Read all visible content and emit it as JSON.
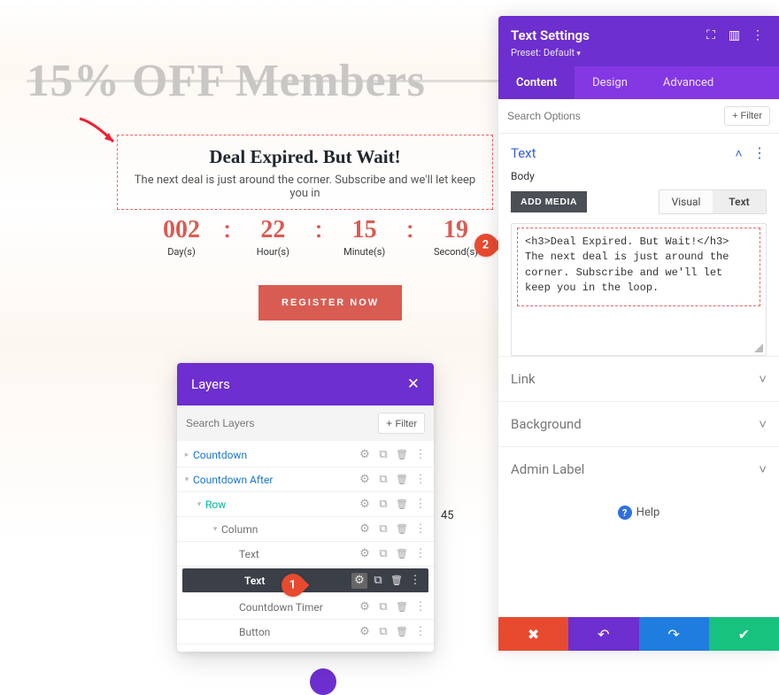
{
  "hero": {
    "strike_text": "15% OFF Members"
  },
  "deal": {
    "heading": "Deal Expired. But Wait!",
    "sub": "The next deal is just around the corner. Subscribe and we'll let keep you in"
  },
  "countdown": {
    "days": "002",
    "hours": "22",
    "minutes": "15",
    "seconds": "19",
    "day_lbl": "Day(s)",
    "hour_lbl": "Hour(s)",
    "minute_lbl": "Minute(s)",
    "second_lbl": "Second(s)"
  },
  "cta": {
    "register": "REGISTER NOW"
  },
  "layers": {
    "title": "Layers",
    "search_placeholder": "Search Layers",
    "filter": "Filter",
    "items": [
      {
        "label": "Countdown",
        "depth": 0,
        "cls": "lr-blue",
        "toggle": "▸"
      },
      {
        "label": "Countdown After",
        "depth": 0,
        "cls": "lr-blue",
        "toggle": "▾"
      },
      {
        "label": "Row",
        "depth": 1,
        "cls": "lr-teal",
        "toggle": "▾"
      },
      {
        "label": "Column",
        "depth": 2,
        "cls": "lr-gray",
        "toggle": "▾"
      },
      {
        "label": "Text",
        "depth": 3,
        "cls": "lr-gray",
        "toggle": ""
      },
      {
        "label": "Text",
        "depth": 3,
        "cls": "lr-selected",
        "toggle": ""
      },
      {
        "label": "Countdown Timer",
        "depth": 3,
        "cls": "lr-gray",
        "toggle": ""
      },
      {
        "label": "Button",
        "depth": 3,
        "cls": "lr-gray",
        "toggle": ""
      }
    ]
  },
  "fragment45": "45",
  "steps": {
    "s1": "1",
    "s2": "2"
  },
  "settings": {
    "title": "Text Settings",
    "preset": "Preset: Default",
    "tabs": {
      "content": "Content",
      "design": "Design",
      "advanced": "Advanced"
    },
    "search_placeholder": "Search Options",
    "filter": "Filter",
    "text_section": "Text",
    "body_label": "Body",
    "add_media": "ADD MEDIA",
    "editor_tabs": {
      "visual": "Visual",
      "text": "Text"
    },
    "editor_content": "<h3>Deal Expired. But Wait!</h3>\nThe next deal is just around the corner. Subscribe and we'll let keep you in the loop.",
    "sections": {
      "link": "Link",
      "background": "Background",
      "admin": "Admin Label"
    },
    "help": "Help"
  }
}
